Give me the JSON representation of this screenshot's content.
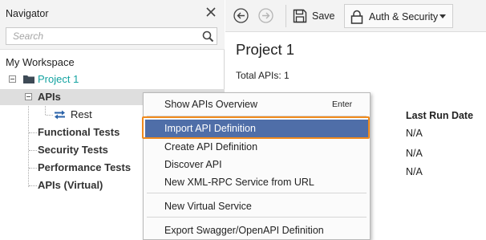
{
  "navigator": {
    "title": "Navigator",
    "search_placeholder": "Search",
    "workspace_label": "My Workspace",
    "tree": {
      "project": "Project 1",
      "apis": "APIs",
      "rest": "Rest",
      "categories": [
        "Functional Tests",
        "Security Tests",
        "Performance Tests",
        "APIs (Virtual)"
      ]
    }
  },
  "toolbar": {
    "save_label": "Save",
    "auth_label": "Auth & Security"
  },
  "main": {
    "project_title": "Project 1",
    "total_apis": "Total APIs: 1",
    "column_header": "Last Run Date",
    "cells": [
      "N/A",
      "N/A",
      "N/A"
    ]
  },
  "context_menu": {
    "items": [
      {
        "label": "Show APIs Overview",
        "shortcut": "Enter"
      },
      {
        "label": "Import API Definition",
        "selected": true
      },
      {
        "label": "Create API Definition"
      },
      {
        "label": "Discover API"
      },
      {
        "label": "New XML-RPC Service from URL"
      },
      {
        "label": "New Virtual Service"
      },
      {
        "label": "Export Swagger/OpenAPI Definition"
      }
    ]
  },
  "colors": {
    "accent_teal": "#14a3a1",
    "menu_selected": "#4f6ea8",
    "highlight_orange": "#f08a1c"
  },
  "icons": [
    "close-icon",
    "search-icon",
    "folder-icon",
    "rest-icon",
    "back-icon",
    "forward-icon",
    "save-icon",
    "lock-icon",
    "chevron-down-icon"
  ]
}
